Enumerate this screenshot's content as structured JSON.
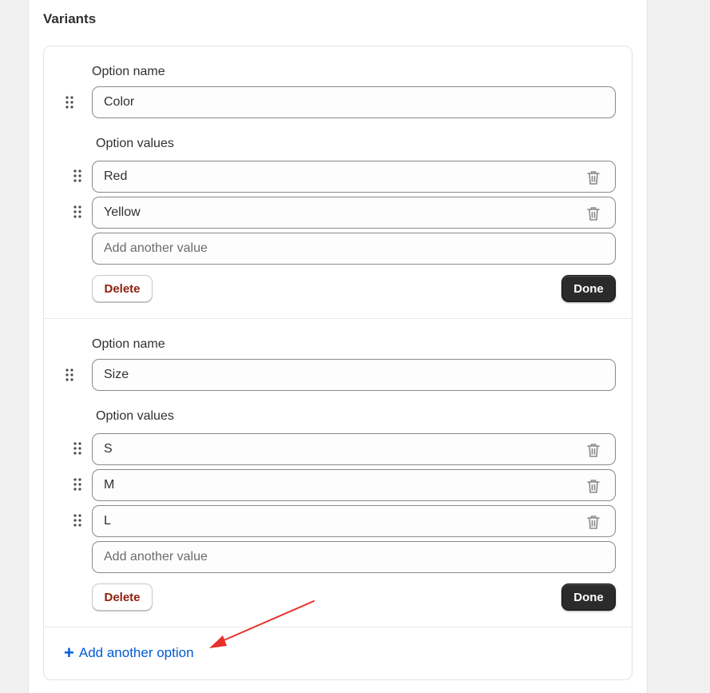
{
  "section": {
    "title": "Variants"
  },
  "options": [
    {
      "name_label": "Option name",
      "name_value": "Color",
      "values_label": "Option values",
      "values": [
        "Red",
        "Yellow"
      ],
      "add_placeholder": "Add another value",
      "delete_label": "Delete",
      "done_label": "Done"
    },
    {
      "name_label": "Option name",
      "name_value": "Size",
      "values_label": "Option values",
      "values": [
        "S",
        "M",
        "L"
      ],
      "add_placeholder": "Add another value",
      "delete_label": "Delete",
      "done_label": "Done"
    }
  ],
  "add_option": {
    "plus": "+",
    "label": "Add another option"
  },
  "icons": {
    "drag": "drag-handle-icon",
    "trash": "trash-icon",
    "arrow": "red-arrow-annotation"
  },
  "colors": {
    "accent_link": "#005bd3",
    "done_bg": "#2b2b2b",
    "delete_text": "#8e1f0b",
    "annotation": "#e8302a"
  }
}
